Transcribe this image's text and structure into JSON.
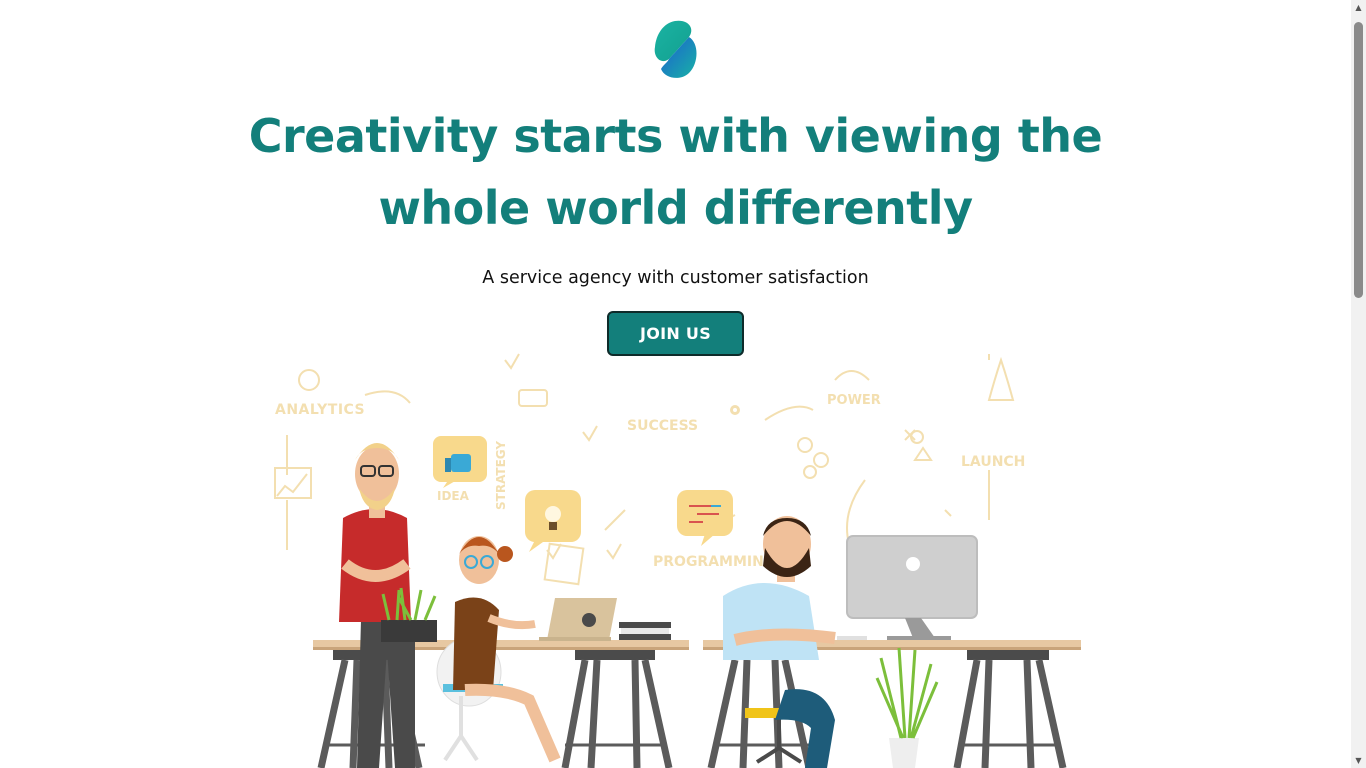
{
  "hero": {
    "headline_line1": "Creativity starts with viewing the",
    "headline_line2": "whole world differently",
    "tagline": "A service agency with customer satisfaction",
    "cta_label": "JOIN US"
  },
  "illustration": {
    "labels": {
      "analytics": "ANALYTICS",
      "success": "SUCCESS",
      "power": "POWER",
      "launch": "LAUNCH",
      "strategy": "STRATEGY",
      "idea": "IDEA",
      "programming": "PROGRAMMING"
    }
  },
  "colors": {
    "brand": "#137f7b",
    "logo_teal": "#1bb3a3",
    "logo_blue": "#1a5fd0",
    "sketch": "#f3dfb0"
  },
  "icons": {
    "logo": "brand-logo-icon",
    "scroll_up": "chevron-up-icon",
    "scroll_down": "chevron-down-icon"
  }
}
